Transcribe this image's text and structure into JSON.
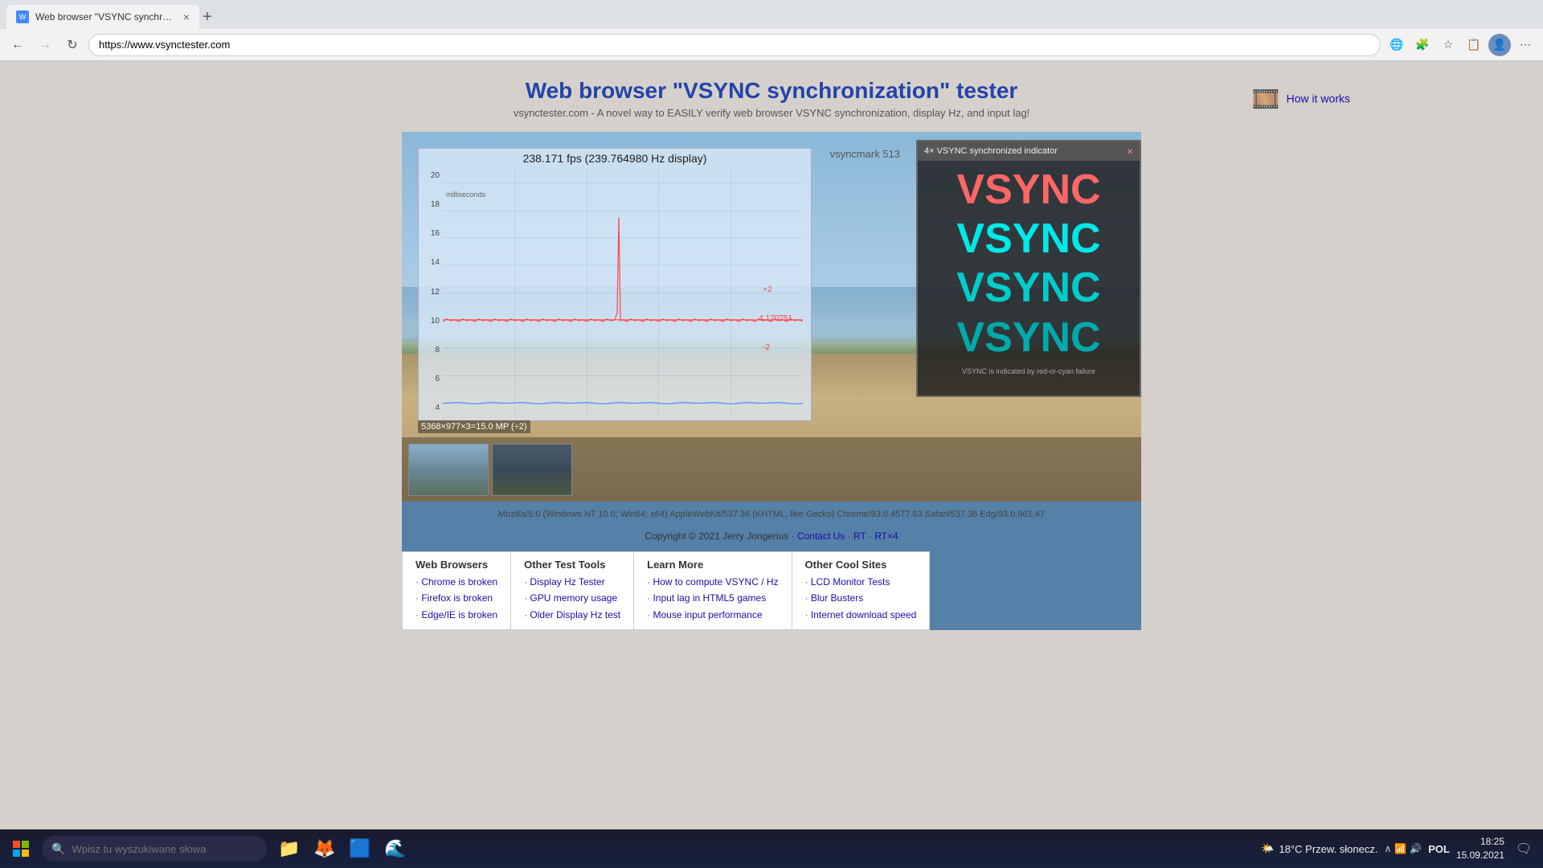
{
  "browser": {
    "tab_title": "Web browser \"VSYNC synchroni...",
    "tab_favicon": "W",
    "url": "https://www.vsynctester.com",
    "nav": {
      "back": "←",
      "forward": "→",
      "refresh": "↻"
    }
  },
  "page": {
    "title": "Web browser \"VSYNC synchronization\" tester",
    "subtitle": "vsynctester.com - A novel way to EASILY verify web browser VSYNC synchronization, display Hz, and input lag!",
    "how_it_works": "How it works"
  },
  "graph": {
    "fps_display": "238.171 fps  (239.764980 Hz display)",
    "vsyncmark": "vsyncmark 513",
    "ms_label": "milliseconds",
    "y_labels": [
      "20",
      "18",
      "16",
      "14",
      "12",
      "10",
      "8",
      "6",
      "4"
    ],
    "right_labels": [
      "+2",
      "4.170751",
      "-2"
    ]
  },
  "vsync_panel": {
    "title": "4× VSYNC synchronized indicator",
    "close": "×",
    "labels": [
      "VSYNC",
      "VSYNC",
      "VSYNC",
      "VSYNC"
    ],
    "note": "VSYNC is indicated by red-or-cyan failure"
  },
  "info_text": "5368×977×3=15.0 MP (÷2)",
  "ua_string": "Mozilla/5.0 (Windows NT 10.0; Win64; x64) AppleWebKit/537.36 (KHTML, like Gecko) Chrome/93.0.4577.63 Safari/537.36 Edg/93.0.961.47",
  "copyright": {
    "text": "Copyright © 2021 Jerry Jongerius ·",
    "contact_us": "Contact Us",
    "rt": "RT",
    "rtx4": "RT×4"
  },
  "footer": {
    "col1": {
      "title": "Web Browsers",
      "links": [
        "Chrome is broken",
        "Firefox is broken",
        "Edge/IE is broken"
      ]
    },
    "col2": {
      "title": "Other Test Tools",
      "links": [
        "Display Hz Tester",
        "GPU memory usage",
        "Older Display Hz test"
      ]
    },
    "col3": {
      "title": "Learn More",
      "links": [
        "How to compute VSYNC / Hz",
        "Input lag in HTML5 games",
        "Mouse input performance"
      ]
    },
    "col4": {
      "title": "Other Cool Sites",
      "links": [
        "LCD Monitor Tests",
        "Blur Busters",
        "Internet download speed"
      ]
    }
  },
  "taskbar": {
    "search_placeholder": "Wpisz tu wyszukiwane słowa",
    "weather": "18°C Przew. słonecz.",
    "clock_time": "18:25",
    "clock_date": "15.09.2021",
    "language": "POL"
  }
}
